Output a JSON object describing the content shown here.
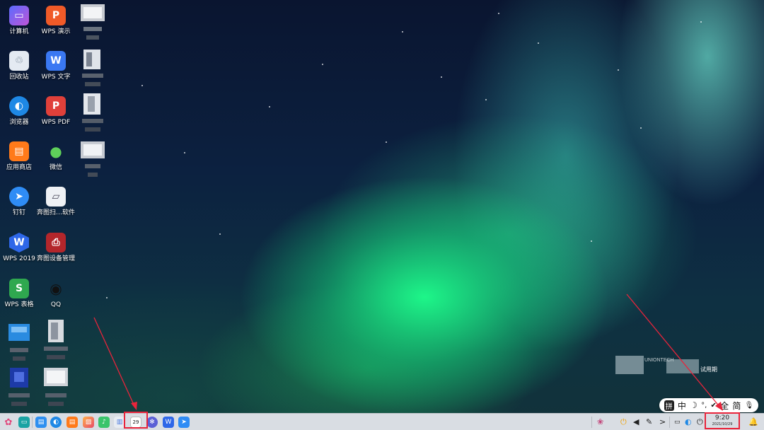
{
  "desktop": {
    "icons": [
      {
        "label": "计算机",
        "icon": "computer-icon"
      },
      {
        "label": "WPS 演示",
        "icon": "wps-presentation-icon"
      },
      {
        "label": "回收站",
        "icon": "trash-icon"
      },
      {
        "label": "WPS 文字",
        "icon": "wps-writer-icon"
      },
      {
        "label": "浏览器",
        "icon": "browser-icon"
      },
      {
        "label": "WPS PDF",
        "icon": "wps-pdf-icon"
      },
      {
        "label": "应用商店",
        "icon": "app-store-icon"
      },
      {
        "label": "微信",
        "icon": "wechat-icon"
      },
      {
        "label": "钉钉",
        "icon": "dingtalk-icon"
      },
      {
        "label": "奔图扫…软件",
        "icon": "scanner-icon"
      },
      {
        "label": "WPS 2019",
        "icon": "wps-2019-icon"
      },
      {
        "label": "奔图设备管理",
        "icon": "printer-manager-icon"
      },
      {
        "label": "WPS 表格",
        "icon": "wps-spreadsheet-icon"
      },
      {
        "label": "QQ",
        "icon": "qq-icon"
      }
    ]
  },
  "watermark": {
    "brand": "UNIONTECH",
    "trial": "试用期"
  },
  "ime": {
    "pinyin": "拼",
    "lang": "中",
    "moon": "☽",
    "punct": "°,",
    "tool": "✔",
    "width": "全",
    "script": "简",
    "mic": "🎙"
  },
  "taskbar": {
    "calendar_day": "29",
    "clock_time": "9:20",
    "clock_date": "2021/10/29",
    "tray_expand": ">"
  },
  "colors": {
    "annotation": "#e8243b",
    "taskbar": "#d9dde3"
  }
}
